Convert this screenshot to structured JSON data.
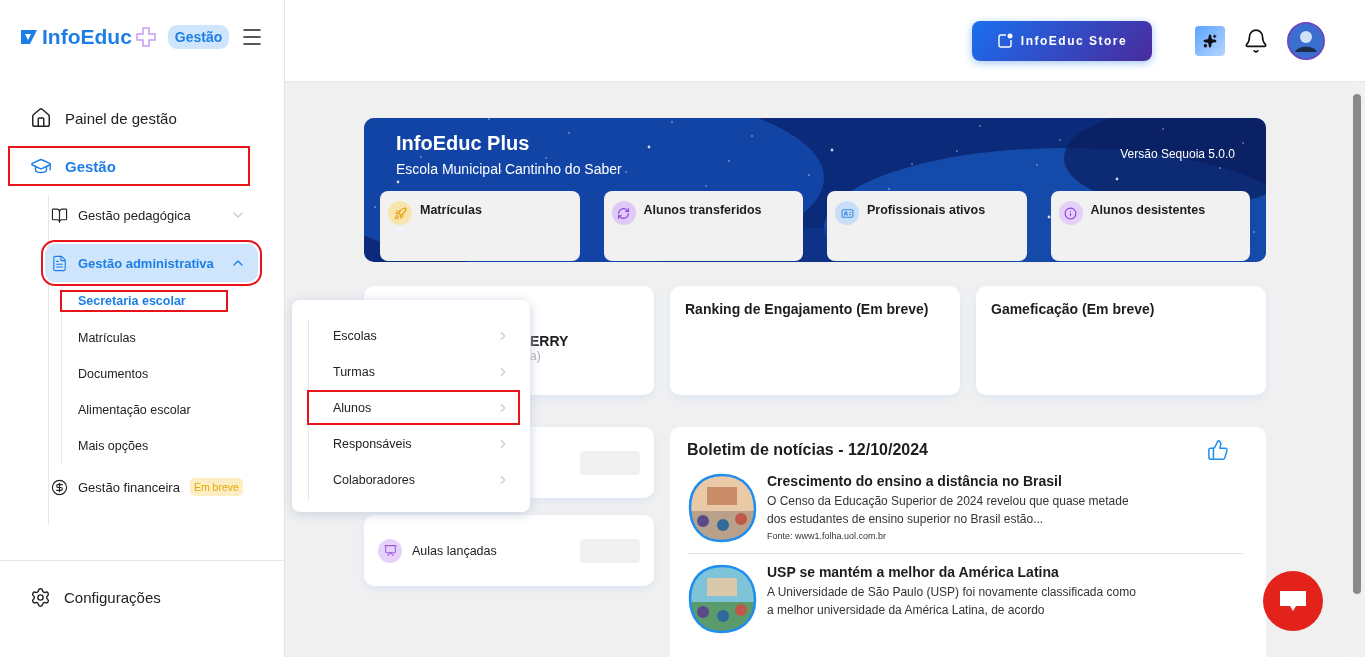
{
  "header": {
    "logo": "InfoEduc",
    "badge": "Gestão",
    "store_button": "InfoEduc Store"
  },
  "sidebar": {
    "items": [
      {
        "label": "Painel de gestão",
        "selected": false,
        "highlighted": false
      },
      {
        "label": "Gestão",
        "selected": true,
        "highlighted": true,
        "expanded": true,
        "children": [
          {
            "label": "Gestão pedagógica",
            "selected": false,
            "highlighted": false,
            "expanded": false
          },
          {
            "label": "Gestão administrativa",
            "selected": true,
            "highlighted": true,
            "expanded": true,
            "children": [
              {
                "label": "Secretaria escolar",
                "selected": true,
                "highlighted": true
              },
              {
                "label": "Matrículas",
                "selected": false,
                "highlighted": false
              },
              {
                "label": "Documentos",
                "selected": false,
                "highlighted": false
              },
              {
                "label": "Alimentação escolar",
                "selected": false,
                "highlighted": false
              },
              {
                "label": "Mais opções",
                "selected": false,
                "highlighted": false
              }
            ]
          },
          {
            "label": "Gestão financeira",
            "selected": false,
            "highlighted": false,
            "badge": "Em breve"
          }
        ]
      }
    ],
    "footer": [
      {
        "label": "Configurações"
      }
    ]
  },
  "banner": {
    "title": "InfoEduc Plus",
    "subtitle": "Escola Municipal Cantinho do Saber",
    "version": "Versão Sequoia 5.0.0",
    "stats": [
      {
        "label": "Matrículas",
        "color": "#f8e4ad"
      },
      {
        "label": "Alunos transferidos",
        "color": "#dfc9f7"
      },
      {
        "label": "Profissionais ativos",
        "color": "#c7dff6"
      },
      {
        "label": "Alunos desistentes",
        "color": "#e3cff7"
      }
    ]
  },
  "profile_card": {
    "name": "ERRY",
    "role": "a)"
  },
  "info_cards": [
    {
      "title": "Ranking de Engajamento (Em breve)"
    },
    {
      "title": "Gameficação (Em breve)"
    }
  ],
  "metrics": [
    {
      "label": "Aulas lançadas"
    }
  ],
  "news": {
    "title": "Boletim de notícias - 12/10/2024",
    "items": [
      {
        "headline": "Crescimento do ensino a distância no Brasil",
        "summary": "O Censo da Educação Superior de 2024 revelou que quase metade dos estudantes de ensino superior no Brasil estão...",
        "source": "Fonte: www1.folha.uol.com.br"
      },
      {
        "headline": "USP se mantém a melhor da América Latina",
        "summary": "A Universidade de São Paulo (USP) foi novamente classificada como a melhor universidade da América Latina, de acordo"
      }
    ]
  },
  "dropdown": {
    "items": [
      {
        "label": "Escolas",
        "highlighted": false
      },
      {
        "label": "Turmas",
        "highlighted": false
      },
      {
        "label": "Alunos",
        "highlighted": true
      },
      {
        "label": "Responsáveis",
        "highlighted": false
      },
      {
        "label": "Colaboradores",
        "highlighted": false
      }
    ]
  }
}
